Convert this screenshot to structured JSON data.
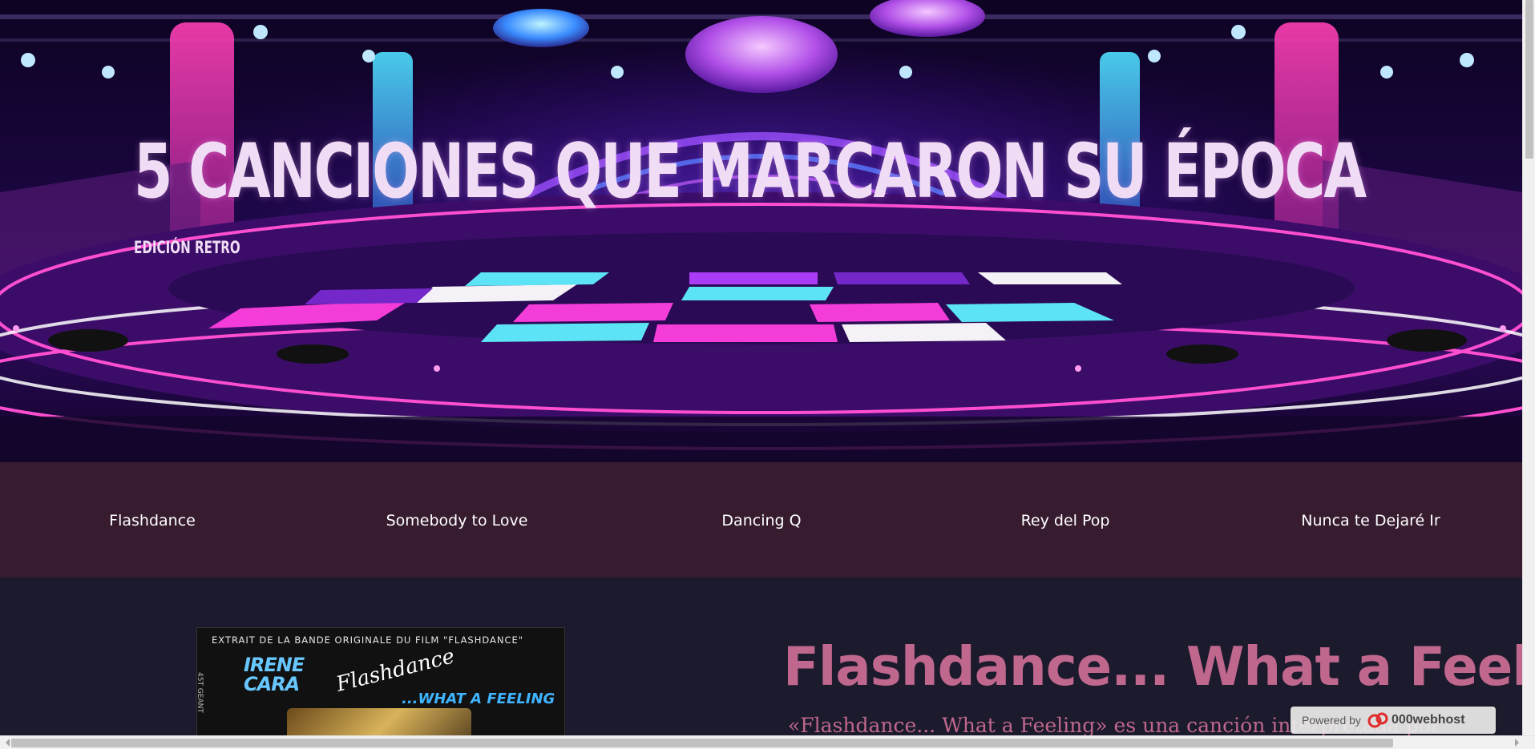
{
  "hero": {
    "title": "5 CANCIONES QUE MARCARON SU ÉPOCA",
    "subtitle": "EDICIÓN RETRO"
  },
  "nav": {
    "items": [
      {
        "label": "Flashdance"
      },
      {
        "label": "Somebody to Love"
      },
      {
        "label": "Dancing Q"
      },
      {
        "label": "Rey del Pop"
      },
      {
        "label": "Nunca te Dejaré Ir"
      }
    ]
  },
  "article": {
    "title": "Flashdance... What a Feeling",
    "text": "«Flashdance... What a Feeling» es una canción interpretada por",
    "cover": {
      "strip": "EXTRAIT DE LA BANDE ORIGINALE DU FILM \"FLASHDANCE\"",
      "artist_line1": "IRENE",
      "artist_line2": "CARA",
      "film": "Flashdance",
      "song": "...WHAT A FEELING",
      "side": "45T GEANT"
    }
  },
  "badge": {
    "label": "Powered by",
    "brand": "000webhost"
  },
  "colors": {
    "nav_bg": "#371c30",
    "main_bg": "#1c1b2d",
    "accent": "#c0678e",
    "title": "#f1dcf6"
  }
}
